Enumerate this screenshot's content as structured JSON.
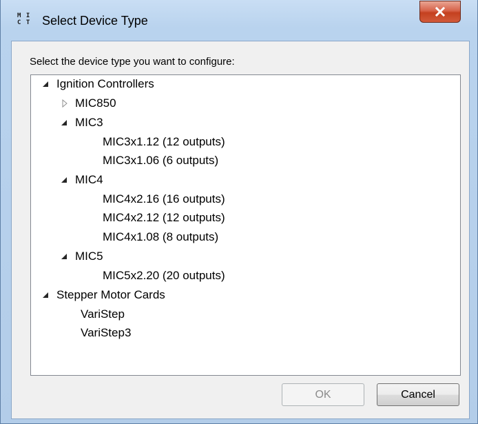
{
  "window": {
    "title": "Select Device Type",
    "icon": "mict-app-icon",
    "icon_text": "M I C T"
  },
  "dialog": {
    "prompt": "Select the device type you want to configure:"
  },
  "tree": {
    "ignition": {
      "label": "Ignition Controllers",
      "expanded": true
    },
    "mic850": {
      "label": "MIC850",
      "expanded": false
    },
    "mic3": {
      "label": "MIC3",
      "expanded": true
    },
    "mic3x1_12": {
      "label": "MIC3x1.12 (12 outputs)"
    },
    "mic3x1_06": {
      "label": "MIC3x1.06 (6 outputs)"
    },
    "mic4": {
      "label": "MIC4",
      "expanded": true
    },
    "mic4x2_16": {
      "label": "MIC4x2.16 (16 outputs)"
    },
    "mic4x2_12": {
      "label": "MIC4x2.12 (12 outputs)"
    },
    "mic4x1_08": {
      "label": "MIC4x1.08 (8 outputs)"
    },
    "mic5": {
      "label": "MIC5",
      "expanded": true
    },
    "mic5x2_20": {
      "label": "MIC5x2.20 (20 outputs)"
    },
    "stepper": {
      "label": "Stepper Motor Cards",
      "expanded": true
    },
    "varistep": {
      "label": "VariStep"
    },
    "varistep3": {
      "label": "VariStep3"
    }
  },
  "buttons": {
    "ok": {
      "label": "OK",
      "enabled": false
    },
    "cancel": {
      "label": "Cancel",
      "enabled": true
    }
  },
  "colors": {
    "frame": "#b9d3ee",
    "close_button": "#c4401f",
    "client_bg": "#f0f0f0"
  }
}
